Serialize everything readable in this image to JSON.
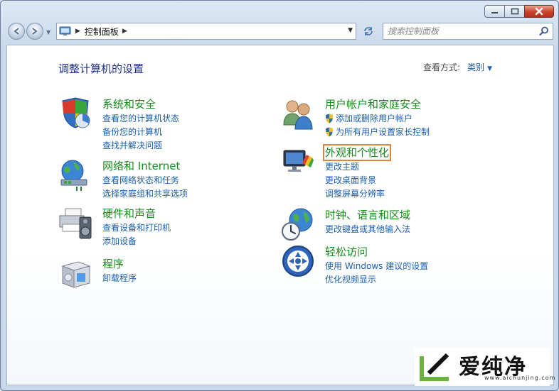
{
  "window": {
    "caption_buttons": [
      "minimize-icon",
      "maximize-icon",
      "close-icon"
    ]
  },
  "navigation": {
    "back_icon": "arrow-left-icon",
    "forward_icon": "arrow-right-icon",
    "breadcrumb": [
      "控制面板"
    ],
    "search": {
      "placeholder": "搜索控制面板"
    }
  },
  "content": {
    "title": "调整计算机的设置",
    "view_by": {
      "label": "查看方式:",
      "value": "类别"
    },
    "left_categories": [
      {
        "title": "系统和安全",
        "icon": "shield-pie-icon",
        "links": [
          "查看您的计算机状态",
          "备份您的计算机",
          "查找并解决问题"
        ]
      },
      {
        "title": "网络和 Internet",
        "icon": "network-globe-icon",
        "links": [
          "查看网络状态和任务",
          "选择家庭组和共享选项"
        ]
      },
      {
        "title": "硬件和声音",
        "icon": "printer-speaker-icon",
        "links": [
          "查看设备和打印机",
          "添加设备"
        ]
      },
      {
        "title": "程序",
        "icon": "programs-box-icon",
        "links": [
          "卸载程序"
        ]
      }
    ],
    "right_categories": [
      {
        "title": "用户帐户和家庭安全",
        "icon": "users-icon",
        "links": [
          "添加或删除用户帐户",
          "为所有用户设置家长控制"
        ]
      },
      {
        "title": "外观和个性化",
        "icon": "monitor-palette-icon",
        "links": [
          "更改主题",
          "更改桌面背景",
          "调整屏幕分辨率"
        ]
      },
      {
        "title": "时钟、语言和区域",
        "icon": "clock-globe-icon",
        "links": [
          "更改键盘或其他输入法"
        ]
      },
      {
        "title": "轻松访问",
        "icon": "ease-of-access-icon",
        "links": [
          "使用 Windows 建议的设置",
          "优化视频显示"
        ]
      }
    ]
  },
  "watermark": {
    "text": "爱纯净",
    "url": "www.aichunjing.com"
  },
  "colors": {
    "category_title": "#168c1b",
    "link": "#1a5fb0",
    "page_title": "#1e3287",
    "highlight": "#e0843c"
  }
}
